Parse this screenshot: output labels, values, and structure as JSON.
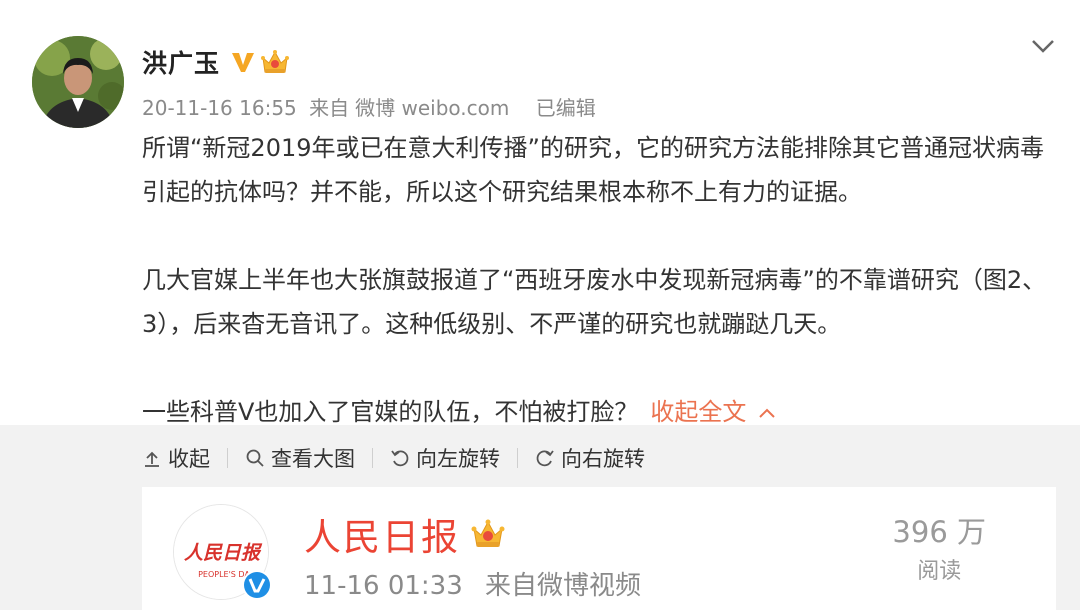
{
  "post": {
    "author": "洪广玉",
    "timestamp": "20-11-16 16:55",
    "source_prefix": "来自",
    "source": "微博 weibo.com",
    "edited": "已编辑",
    "paragraphs": [
      "所谓“新冠2019年或已在意大利传播”的研究，它的研究方法能排除其它普通冠状病毒引起的抗体吗？并不能，所以这个研究结果根本称不上有力的证据。",
      "几大官媒上半年也大张旗鼓报道了“西班牙废水中发现新冠病毒”的不靠谱研究（图2、3），后来杳无音讯了。这种低级别、不严谨的研究也就蹦跶几天。",
      "一些科普V也加入了官媒的队伍，不怕被打脸？"
    ],
    "collapse_label": "收起全文",
    "icons": {
      "verified": "verified-v-icon",
      "crown": "member-crown-icon",
      "more": "chevron-down-icon",
      "collapse": "chevron-up-icon"
    }
  },
  "toolbar": {
    "items": [
      {
        "label": "收起",
        "icon": "collapse-up-icon"
      },
      {
        "label": "查看大图",
        "icon": "search-icon"
      },
      {
        "label": "向左旋转",
        "icon": "rotate-left-icon"
      },
      {
        "label": "向右旋转",
        "icon": "rotate-right-icon"
      }
    ]
  },
  "embedded_card": {
    "name": "人民日报",
    "logo_text": "人民日报",
    "logo_subtext": "PEOPLE'S DA",
    "timestamp": "11-16 01:33",
    "source": "来自微博视频",
    "reads_count": "396 万",
    "reads_label": "阅读"
  },
  "colors": {
    "accent": "#eb7350",
    "card_name": "#eb4434",
    "verified_gold": "#f5a623",
    "verified_blue": "#1f8fe5",
    "toolbar_bg": "#f2f2f2"
  }
}
